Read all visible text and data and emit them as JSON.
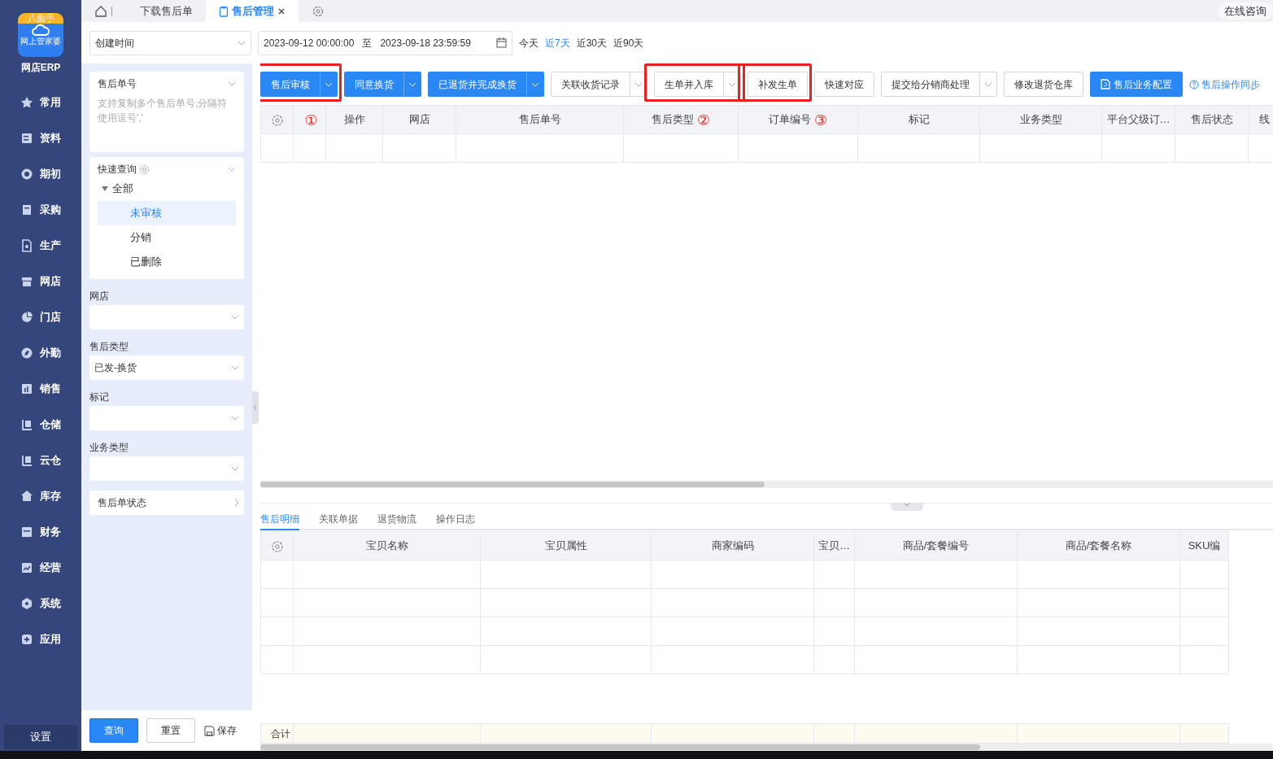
{
  "logo": {
    "banner": "八面手",
    "caption": "网上管家婆",
    "app_name": "网店ERP"
  },
  "nav": {
    "items": [
      {
        "label": "常用"
      },
      {
        "label": "资料"
      },
      {
        "label": "期初"
      },
      {
        "label": "采购"
      },
      {
        "label": "生产"
      },
      {
        "label": "网店"
      },
      {
        "label": "门店"
      },
      {
        "label": "外勤"
      },
      {
        "label": "销售"
      },
      {
        "label": "仓储"
      },
      {
        "label": "云仓"
      },
      {
        "label": "库存"
      },
      {
        "label": "财务"
      },
      {
        "label": "经营"
      },
      {
        "label": "系统"
      },
      {
        "label": "应用"
      }
    ],
    "footer": "设置"
  },
  "top_tabs": [
    {
      "label": "下载售后单",
      "selected": false,
      "closable": false
    },
    {
      "label": "售后管理",
      "selected": true,
      "closable": true
    }
  ],
  "consult_button": "在线咨询",
  "filter": {
    "date_field": "创建时间",
    "start": "2023-09-12 00:00:00",
    "separator": "至",
    "end": "2023-09-18 23:59:59",
    "shortcuts": [
      {
        "label": "今天",
        "selected": false
      },
      {
        "label": "近7天",
        "selected": true
      },
      {
        "label": "近30天",
        "selected": false
      },
      {
        "label": "近90天",
        "selected": false
      }
    ]
  },
  "side_panel": {
    "order_no": {
      "label": "售后单号",
      "placeholder": "支持复制多个售后单号,分隔符使用逗号','"
    },
    "quick_query": {
      "title": "快速查询",
      "tree": [
        {
          "label": "全部",
          "expanded": true,
          "children": [
            {
              "label": "未审核",
              "selected": true
            },
            {
              "label": "分销",
              "selected": false
            },
            {
              "label": "已删除",
              "selected": false
            }
          ]
        }
      ]
    },
    "fields": [
      {
        "label": "网店"
      },
      {
        "label": "售后类型",
        "value": "已发-换货"
      },
      {
        "label": "标记"
      },
      {
        "label": "业务类型"
      }
    ],
    "status_filter": "售后单状态",
    "actions": [
      {
        "label": "查询",
        "kind": "primary"
      },
      {
        "label": "重置",
        "kind": "default"
      },
      {
        "label": "保存",
        "kind": "link"
      }
    ]
  },
  "toolbar": {
    "buttons": [
      {
        "label": "售后审核",
        "kind": "primary",
        "dropdown": true,
        "highlighted": true
      },
      {
        "label": "同意换货",
        "kind": "primary",
        "dropdown": true,
        "highlighted": false
      },
      {
        "label": "已退货并完成换货",
        "kind": "primary",
        "dropdown": true,
        "highlighted": false
      },
      {
        "label": "关联收货记录",
        "kind": "default",
        "dropdown": true,
        "highlighted": false
      },
      {
        "label": "生单并入库",
        "kind": "default",
        "dropdown": true,
        "highlighted": true
      },
      {
        "label": "补发生单",
        "kind": "default",
        "dropdown": false,
        "highlighted": true
      },
      {
        "label": "快速对应",
        "kind": "default",
        "dropdown": false,
        "highlighted": false
      },
      {
        "label": "提交给分销商处理",
        "kind": "default",
        "dropdown": true,
        "highlighted": false
      },
      {
        "label": "修改退货仓库",
        "kind": "default",
        "dropdown": false,
        "highlighted": false
      },
      {
        "label": "售后业务配置",
        "kind": "config",
        "dropdown": false,
        "highlighted": false
      }
    ],
    "help_link": "售后操作同步"
  },
  "main_table": {
    "columns": [
      {
        "kind": "settings"
      },
      {
        "kind": "checkbox",
        "marker": "①"
      },
      {
        "label": "操作"
      },
      {
        "label": "网店"
      },
      {
        "label": "售后单号"
      },
      {
        "label": "售后类型",
        "marker": "②"
      },
      {
        "label": "订单编号",
        "marker": "③"
      },
      {
        "label": "标记"
      },
      {
        "label": "业务类型"
      },
      {
        "label": "平台父级订…"
      },
      {
        "label": "售后状态"
      },
      {
        "label": "线"
      }
    ]
  },
  "detail_tabs": [
    {
      "label": "售后明细",
      "selected": true
    },
    {
      "label": "关联单据",
      "selected": false
    },
    {
      "label": "退货物流",
      "selected": false
    },
    {
      "label": "操作日志",
      "selected": false
    }
  ],
  "detail_table": {
    "columns": [
      {
        "kind": "settings"
      },
      {
        "label": "宝贝名称"
      },
      {
        "label": "宝贝属性"
      },
      {
        "label": "商家编码"
      },
      {
        "label": "宝贝…"
      },
      {
        "label": "商品/套餐编号"
      },
      {
        "label": "商品/套餐名称"
      },
      {
        "label": "SKU编"
      }
    ],
    "total_label": "合计"
  }
}
